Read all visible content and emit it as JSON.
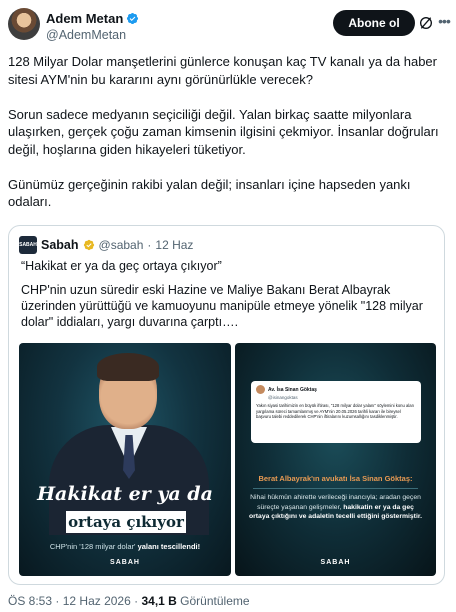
{
  "author": {
    "name": "Adem Metan",
    "handle": "@AdemMetan",
    "follow_label": "Abone ol"
  },
  "tweet": {
    "paragraphs": [
      "128 Milyar Dolar manşetlerini günlerce konuşan kaç TV kanalı ya da haber sitesi AYM'nin bu kararını aynı görünürlükle verecek?",
      "Sorun sadece medyanın seçiciliği değil. Yalan birkaç saatte milyonlara ulaşırken, gerçek çoğu zaman kimsenin ilgisini çekmiyor. İnsanlar doğruları değil, hoşlarına giden hikayeleri tüketiyor.",
      "Günümüz gerçeğinin rakibi yalan değil; insanları içine hapseden yankı odaları."
    ]
  },
  "quote": {
    "logo_text": "SABAH",
    "name": "Sabah",
    "handle": "@sabah",
    "date": "12 Haz",
    "separator": "·",
    "headline": "“Hakikat er ya da geç ortaya çıkıyor”",
    "body": "CHP'nin uzun süredir eski Hazine ve Maliye Bakanı Berat Albayrak üzerinden yürüttüğü ve kamuoyunu manipüle etmeye yönelik \"128 milyar dolar\" iddiaları, yargı duvarına çarptı…."
  },
  "image_left": {
    "headline_1": "Hakikat er ya da geç",
    "headline_2": "ortaya çıkıyor",
    "caption_prefix": "CHP'nin '128 milyar dolar'",
    "caption_bold": "yalanı tescillendi!",
    "brand": "SABAH"
  },
  "image_right": {
    "card_name": "Av. İsa Sinan Göktaş",
    "card_handle": "@isinangoktas",
    "card_text": "Yakın siyasi tarihimizin en büyük iftirası, \"128 milyar dolar yalanı\" söylemini konu alan yargılama süreci tamamlanmış ve AYM'nin 20.05.2026 tarihli kararı ile bireysel başvuru talebi reddedilerek CHP'nin iftiralarını kuzumsallığını tasdiklenmiştir.",
    "title": "Berat Albayrak'ın avukatı İsa Sinan Göktaş:",
    "body_1": "Nihai hükmün ahirette verileceği inancıyla; aradan geçen süreçte yaşanan gelişmeler,",
    "body_bold": "hakikatin er ya da geç ortaya çıktığını ve adaletin tecelli ettiğini göstermiştir.",
    "brand": "SABAH"
  },
  "footer": {
    "time": "ÖS 8:53",
    "separator": "·",
    "date": "12 Haz 2026",
    "views": "34,1 B",
    "views_label": "Görüntüleme"
  },
  "colors": {
    "verified_blue": "#1d9bf0",
    "gold_badge": "#e8b923",
    "text_primary": "#0f1419",
    "text_secondary": "#536471",
    "accent_orange": "#e89a53"
  }
}
